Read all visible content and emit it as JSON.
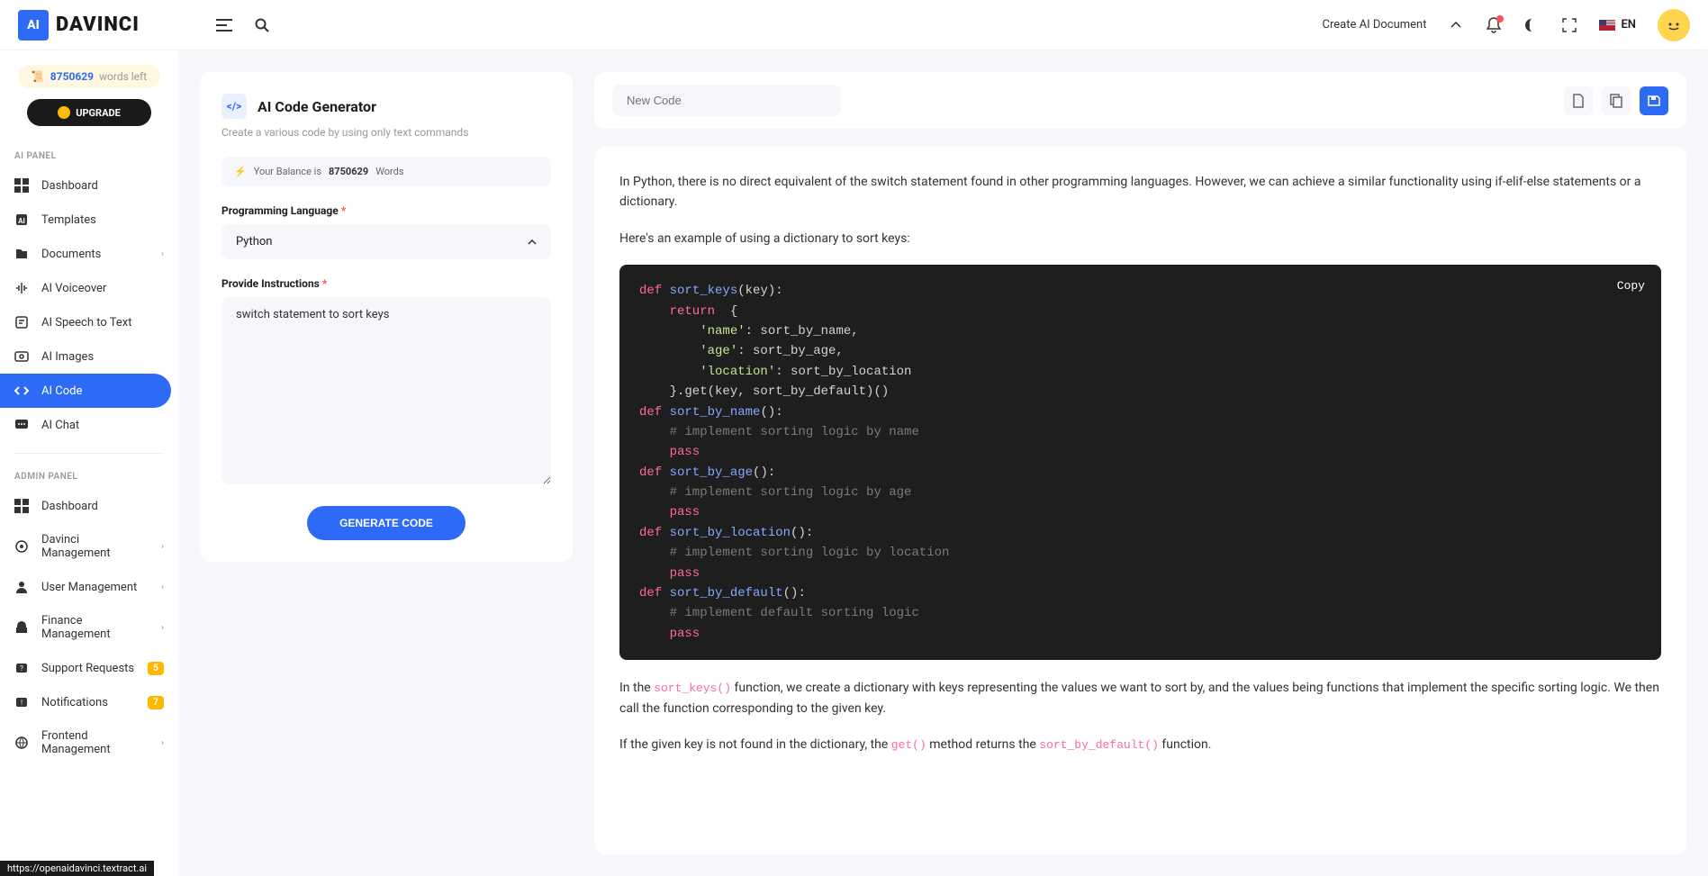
{
  "header": {
    "logo_ai": "AI",
    "logo_text": "Davinci",
    "create_doc": "Create AI Document",
    "lang": "EN"
  },
  "sidebar": {
    "balance_icon": "📜",
    "balance_num": "8750629",
    "balance_label": "words left",
    "upgrade": "UPGRADE",
    "section_ai": "AI PANEL",
    "section_admin": "ADMIN PANEL",
    "ai_items": [
      {
        "label": "Dashboard"
      },
      {
        "label": "Templates"
      },
      {
        "label": "Documents",
        "chevron": true
      },
      {
        "label": "AI Voiceover"
      },
      {
        "label": "AI Speech to Text"
      },
      {
        "label": "AI Images"
      },
      {
        "label": "AI Code",
        "active": true
      },
      {
        "label": "AI Chat"
      }
    ],
    "admin_items": [
      {
        "label": "Dashboard"
      },
      {
        "label": "Davinci Management",
        "chevron": true
      },
      {
        "label": "User Management",
        "chevron": true
      },
      {
        "label": "Finance Management",
        "chevron": true
      },
      {
        "label": "Support Requests",
        "badge": "5"
      },
      {
        "label": "Notifications",
        "badge": "7"
      },
      {
        "label": "Frontend Management",
        "chevron": true
      }
    ]
  },
  "form": {
    "title": "AI Code Generator",
    "subtitle": "Create a various code by using only text commands",
    "balance_prefix": "Your Balance is",
    "balance_amount": "8750629",
    "balance_suffix": "Words",
    "lang_label": "Programming Language",
    "lang_value": "Python",
    "instr_label": "Provide Instructions",
    "instr_value": "switch statement to sort keys",
    "generate": "GENERATE CODE"
  },
  "output": {
    "title_placeholder": "New Code",
    "intro": "In Python, there is no direct equivalent of the switch statement found in other programming languages. However, we can achieve a similar functionality using if-elif-else statements or a dictionary.",
    "example_intro": "Here's an example of using a dictionary to sort keys:",
    "copy": "Copy",
    "explain1_pre": "In the ",
    "explain1_code": "sort_keys()",
    "explain1_post": " function, we create a dictionary with keys representing the values we want to sort by, and the values being functions that implement the specific sorting logic. We then call the function corresponding to the given key.",
    "explain2_pre": "If the given key is not found in the dictionary, the ",
    "explain2_code1": "get()",
    "explain2_mid": " method returns the ",
    "explain2_code2": "sort_by_default()",
    "explain2_post": " function."
  },
  "code": {
    "l1_def": "def",
    "l1_fn": " sort_keys",
    "l1_rest": "(key):",
    "l2_ret": "    return",
    "l2_rest": "  {",
    "l3_str": "        'name'",
    "l3_rest": ": sort_by_name,",
    "l4_str": "        'age'",
    "l4_rest": ": sort_by_age,",
    "l5_str": "        'location'",
    "l5_rest": ": sort_by_location",
    "l6": "    }.get(key, sort_by_default)()",
    "blank": "",
    "l8_def": "def",
    "l8_fn": " sort_by_name",
    "l8_rest": "():",
    "l9": "    # implement sorting logic by name",
    "l10": "    pass",
    "l12_def": "def",
    "l12_fn": " sort_by_age",
    "l12_rest": "():",
    "l13": "    # implement sorting logic by age",
    "l16_def": "def",
    "l16_fn": " sort_by_location",
    "l16_rest": "():",
    "l17": "    # implement sorting logic by location",
    "l20_def": "def",
    "l20_fn": " sort_by_default",
    "l20_rest": "():",
    "l21": "    # implement default sorting logic"
  },
  "status_url": "https://openaidavinci.textract.ai"
}
